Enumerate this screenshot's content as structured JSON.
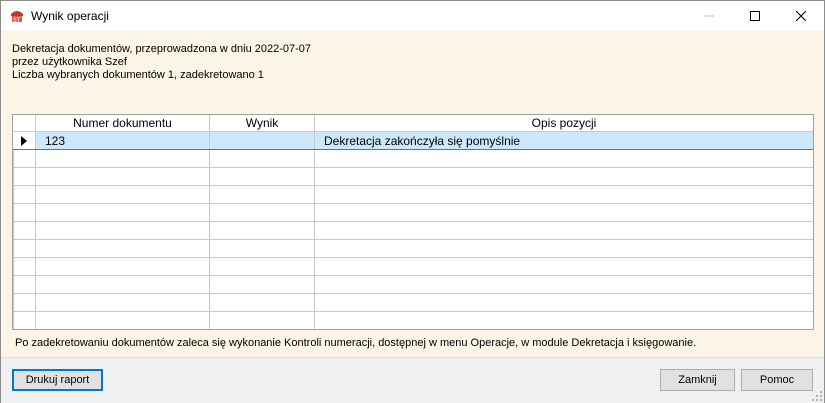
{
  "window": {
    "title": "Wynik operacji"
  },
  "info": {
    "line1": "Dekretacja dokumentów, przeprowadzona w dniu 2022-07-07",
    "line2": "przez użytkownika  Szef",
    "line3": "Liczba wybranych dokumentów 1, zadekretowano 1"
  },
  "grid": {
    "columns": [
      "Numer dokumentu",
      "Wynik",
      "Opis pozycji"
    ],
    "rows": [
      {
        "numer": "123",
        "wynik": "",
        "opis": "Dekretacja zakończyła się pomyślnie"
      }
    ]
  },
  "hint": "Po zadekretowaniu dokumentów zaleca się wykonanie Kontroli numeracji, dostępnej w menu Operacje, w module Dekretacja i księgowanie.",
  "buttons": {
    "print": "Drukuj raport",
    "close": "Zamknij",
    "help": "Pomoc"
  }
}
